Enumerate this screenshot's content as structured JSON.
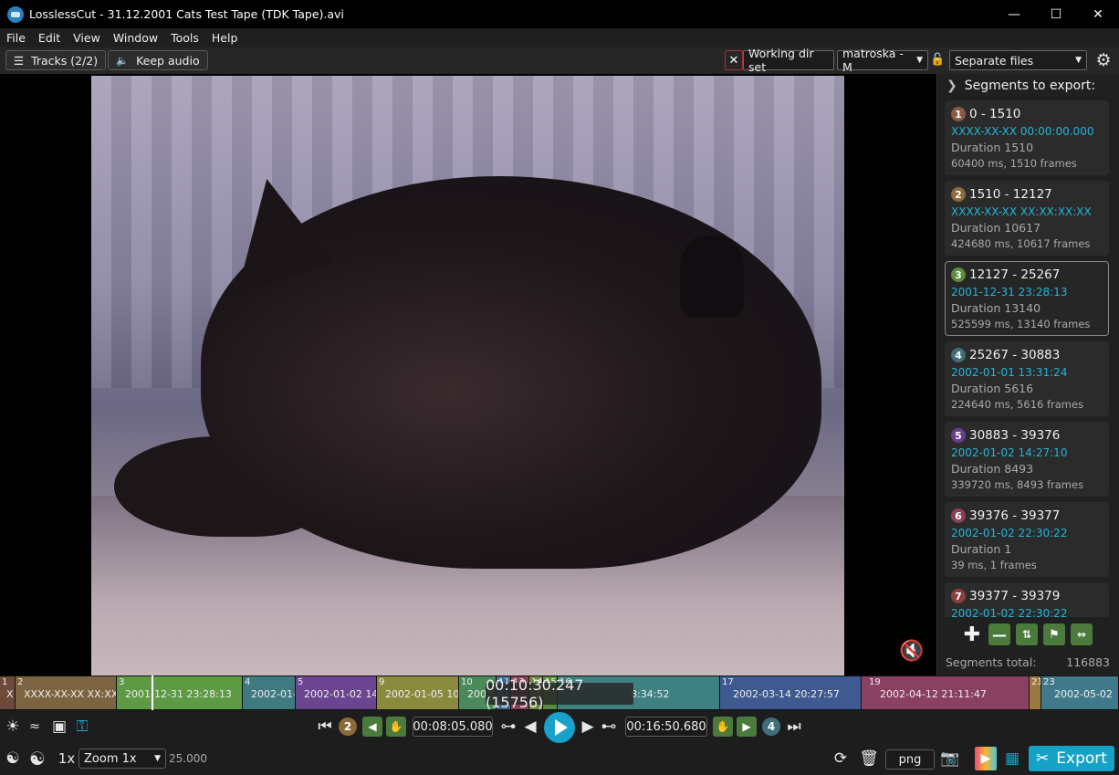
{
  "window": {
    "title": "LosslessCut - 31.12.2001 Cats Test Tape (TDK Tape).avi",
    "minimize_glyph": "—",
    "maximize_glyph": "☐",
    "close_glyph": "✕"
  },
  "menu": [
    "File",
    "Edit",
    "View",
    "Window",
    "Tools",
    "Help"
  ],
  "toolbar": {
    "tracks_label": "Tracks (2/2)",
    "keep_audio_label": "Keep audio",
    "working_dir_label": "Working dir set",
    "format_value": "matroska - M",
    "output_mode_value": "Separate files",
    "clear_glyph": "✕"
  },
  "segments_panel": {
    "header": "Segments to export:",
    "segments": [
      {
        "num": "1",
        "color": "#8a5a45",
        "range": "0 - 1510",
        "date": "XXXX-XX-XX 00:00:00.000",
        "duration": "Duration 1510",
        "frames": "60400 ms, 1510 frames"
      },
      {
        "num": "2",
        "color": "#8b6a3a",
        "range": "1510 - 12127",
        "date": "XXXX-XX-XX XX:XX:XX:XX",
        "duration": "Duration 10617",
        "frames": "424680 ms, 10617 frames"
      },
      {
        "num": "3",
        "color": "#5b8a3b",
        "range": "12127 - 25267",
        "date": "2001-12-31 23:28:13",
        "duration": "Duration 13140",
        "frames": "525599 ms, 13140 frames"
      },
      {
        "num": "4",
        "color": "#3f6e78",
        "range": "25267 - 30883",
        "date": "2002-01-01 13:31:24",
        "duration": "Duration 5616",
        "frames": "224640 ms, 5616 frames"
      },
      {
        "num": "5",
        "color": "#6a3f8a",
        "range": "30883 - 39376",
        "date": "2002-01-02 14:27:10",
        "duration": "Duration 8493",
        "frames": "339720 ms, 8493 frames"
      },
      {
        "num": "6",
        "color": "#8a3f5a",
        "range": "39376 - 39377",
        "date": "2002-01-02 22:30:22",
        "duration": "Duration 1",
        "frames": "39 ms, 1 frames"
      },
      {
        "num": "7",
        "color": "#8a3f3f",
        "range": "39377 - 39379",
        "date": "2002-01-02 22:30:22",
        "duration": "",
        "frames": ""
      }
    ],
    "total_label": "Segments total:",
    "total_value": "116883"
  },
  "timeline": {
    "current_time": "00:10:30.247 (15756)",
    "segments": [
      {
        "num": "1",
        "label": "X",
        "color": "#6f4a3a"
      },
      {
        "num": "2",
        "label": "XXXX-XX-XX XX:XX:X",
        "color": "#7d6440"
      },
      {
        "num": "3",
        "label": "2001-12-31 23:28:13",
        "color": "#5e9a44"
      },
      {
        "num": "4",
        "label": "2002-01-0",
        "color": "#3f7a80"
      },
      {
        "num": "5",
        "label": "2002-01-02 14:2",
        "color": "#6b4590"
      },
      {
        "num": "9",
        "label": "2002-01-05 10:5",
        "color": "#8a8a3f"
      },
      {
        "num": "10",
        "label": "200",
        "color": "#4a8a5a"
      },
      {
        "num": "11",
        "label": "",
        "color": "#3f6a8a"
      },
      {
        "num": "13",
        "label": "",
        "color": "#8a3f5a"
      },
      {
        "num": "14",
        "label": "",
        "color": "#6a8a3f"
      },
      {
        "num": "15",
        "label": "",
        "color": "#5a8a3f"
      },
      {
        "num": "16",
        "label": "8:34:52",
        "color": "#3f8080"
      },
      {
        "num": "17",
        "label": "2002-03-14 20:27:57",
        "color": "#3f5a90"
      },
      {
        "num": "19",
        "label": "2002-04-12 21:11:47",
        "color": "#8a4060"
      },
      {
        "num": "21",
        "label": "",
        "color": "#9a7a40"
      },
      {
        "num": "23",
        "label": "2002-05-02",
        "color": "#407a8a"
      }
    ]
  },
  "transport": {
    "cut_start_time": "00:08:05.080",
    "cut_end_time": "00:16:50.680",
    "prev_segment_badge": "2",
    "next_segment_badge": "4"
  },
  "bottom": {
    "speed_label": "1x",
    "zoom_value": "Zoom 1x",
    "zoom_factor": "25.000",
    "capture_format": "png",
    "export_label": "Export"
  }
}
